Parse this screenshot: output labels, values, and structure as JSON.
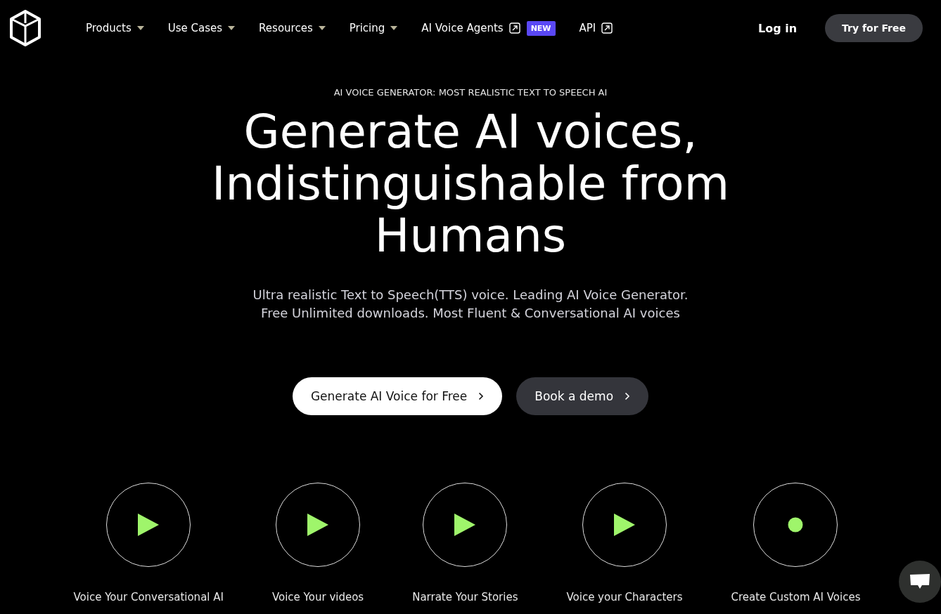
{
  "nav": {
    "items": [
      {
        "label": "Products",
        "kind": "dropdown"
      },
      {
        "label": "Use Cases",
        "kind": "dropdown"
      },
      {
        "label": "Resources",
        "kind": "dropdown"
      },
      {
        "label": "Pricing",
        "kind": "dropdown"
      },
      {
        "label": "AI Voice Agents",
        "kind": "external",
        "badge": "NEW"
      },
      {
        "label": "API",
        "kind": "external"
      }
    ],
    "login": "Log in",
    "cta": "Try for Free"
  },
  "hero": {
    "eyebrow": "AI VOICE GENERATOR: MOST REALISTIC TEXT TO SPEECH AI",
    "headline": [
      "Generate AI voices,",
      "Indistinguishable from",
      "Humans"
    ],
    "subtitle": [
      "Ultra realistic Text to Speech(TTS) voice. Leading AI Voice Generator.",
      "Free Unlimited downloads. Most Fluent & Conversational AI voices"
    ],
    "buttons": [
      {
        "label": "Generate AI Voice for Free",
        "kind": "primary"
      },
      {
        "label": "Book a demo",
        "kind": "secondary"
      }
    ]
  },
  "features": [
    {
      "label": "Voice Your Conversational AI",
      "kind": "play"
    },
    {
      "label": "Voice Your videos",
      "kind": "play"
    },
    {
      "label": "Narrate Your Stories",
      "kind": "play"
    },
    {
      "label": "Voice your Characters",
      "kind": "play"
    },
    {
      "label": "Create Custom AI Voices",
      "kind": "record"
    }
  ]
}
